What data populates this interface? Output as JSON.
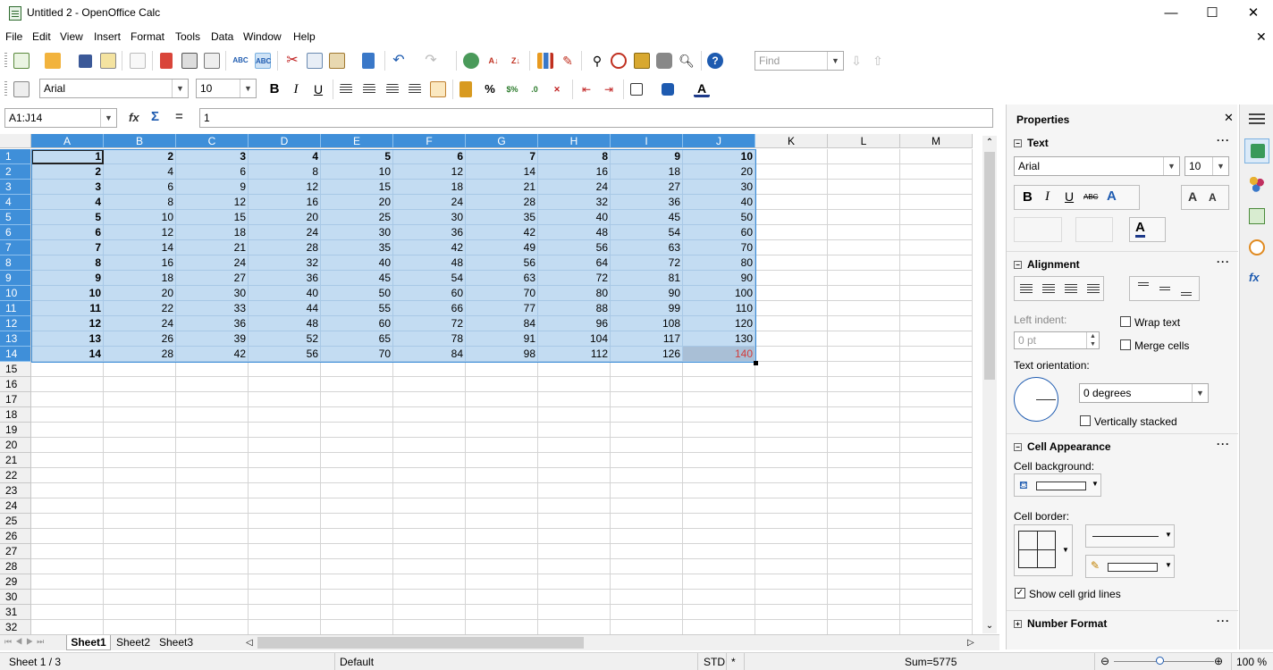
{
  "window": {
    "title": "Untitled 2 - OpenOffice Calc",
    "minimize": "—",
    "maximize": "☐",
    "close": "✕",
    "doc_close": "✕"
  },
  "menu": [
    "File",
    "Edit",
    "View",
    "Insert",
    "Format",
    "Tools",
    "Data",
    "Window",
    "Help"
  ],
  "toolbar": {
    "find_placeholder": "Find"
  },
  "format_toolbar": {
    "font": "Arial",
    "size": "10"
  },
  "formula_bar": {
    "name_box": "A1:J14",
    "content": "1"
  },
  "columns": [
    "A",
    "B",
    "C",
    "D",
    "E",
    "F",
    "G",
    "H",
    "I",
    "J",
    "K",
    "L",
    "M"
  ],
  "rows": [
    "1",
    "2",
    "3",
    "4",
    "5",
    "6",
    "7",
    "8",
    "9",
    "10",
    "11",
    "12",
    "13",
    "14",
    "15",
    "16",
    "17",
    "18",
    "19",
    "20",
    "21",
    "22",
    "23",
    "24",
    "25",
    "26",
    "27",
    "28",
    "29",
    "30",
    "31",
    "32"
  ],
  "cells": [
    [
      "1",
      "2",
      "3",
      "4",
      "5",
      "6",
      "7",
      "8",
      "9",
      "10"
    ],
    [
      "2",
      "4",
      "6",
      "8",
      "10",
      "12",
      "14",
      "16",
      "18",
      "20"
    ],
    [
      "3",
      "6",
      "9",
      "12",
      "15",
      "18",
      "21",
      "24",
      "27",
      "30"
    ],
    [
      "4",
      "8",
      "12",
      "16",
      "20",
      "24",
      "28",
      "32",
      "36",
      "40"
    ],
    [
      "5",
      "10",
      "15",
      "20",
      "25",
      "30",
      "35",
      "40",
      "45",
      "50"
    ],
    [
      "6",
      "12",
      "18",
      "24",
      "30",
      "36",
      "42",
      "48",
      "54",
      "60"
    ],
    [
      "7",
      "14",
      "21",
      "28",
      "35",
      "42",
      "49",
      "56",
      "63",
      "70"
    ],
    [
      "8",
      "16",
      "24",
      "32",
      "40",
      "48",
      "56",
      "64",
      "72",
      "80"
    ],
    [
      "9",
      "18",
      "27",
      "36",
      "45",
      "54",
      "63",
      "72",
      "81",
      "90"
    ],
    [
      "10",
      "20",
      "30",
      "40",
      "50",
      "60",
      "70",
      "80",
      "90",
      "100"
    ],
    [
      "11",
      "22",
      "33",
      "44",
      "55",
      "66",
      "77",
      "88",
      "99",
      "110"
    ],
    [
      "12",
      "24",
      "36",
      "48",
      "60",
      "72",
      "84",
      "96",
      "108",
      "120"
    ],
    [
      "13",
      "26",
      "39",
      "52",
      "65",
      "78",
      "91",
      "104",
      "117",
      "130"
    ],
    [
      "14",
      "28",
      "42",
      "56",
      "70",
      "84",
      "98",
      "112",
      "126",
      "140"
    ]
  ],
  "sheets": [
    "Sheet1",
    "Sheet2",
    "Sheet3"
  ],
  "status": {
    "sheet": "Sheet 1 / 3",
    "style": "Default",
    "mode": "STD",
    "modified": "*",
    "sum": "Sum=5775",
    "zoom": "100 %"
  },
  "sidebar": {
    "title": "Properties",
    "text_section": "Text",
    "font": "Arial",
    "size": "10",
    "alignment_section": "Alignment",
    "left_indent_label": "Left indent:",
    "left_indent_value": "0 pt",
    "wrap_text": "Wrap text",
    "merge_cells": "Merge cells",
    "text_orientation_label": "Text orientation:",
    "orientation_value": "0 degrees",
    "vertically_stacked": "Vertically stacked",
    "cell_appearance_section": "Cell Appearance",
    "cell_background_label": "Cell background:",
    "cell_border_label": "Cell border:",
    "show_grid": "Show cell grid lines",
    "number_format_section": "Number Format"
  },
  "colors": {
    "selection": "#c3dcf2",
    "header_selected": "#3f8fd9",
    "accent_red": "#d23c3c"
  }
}
